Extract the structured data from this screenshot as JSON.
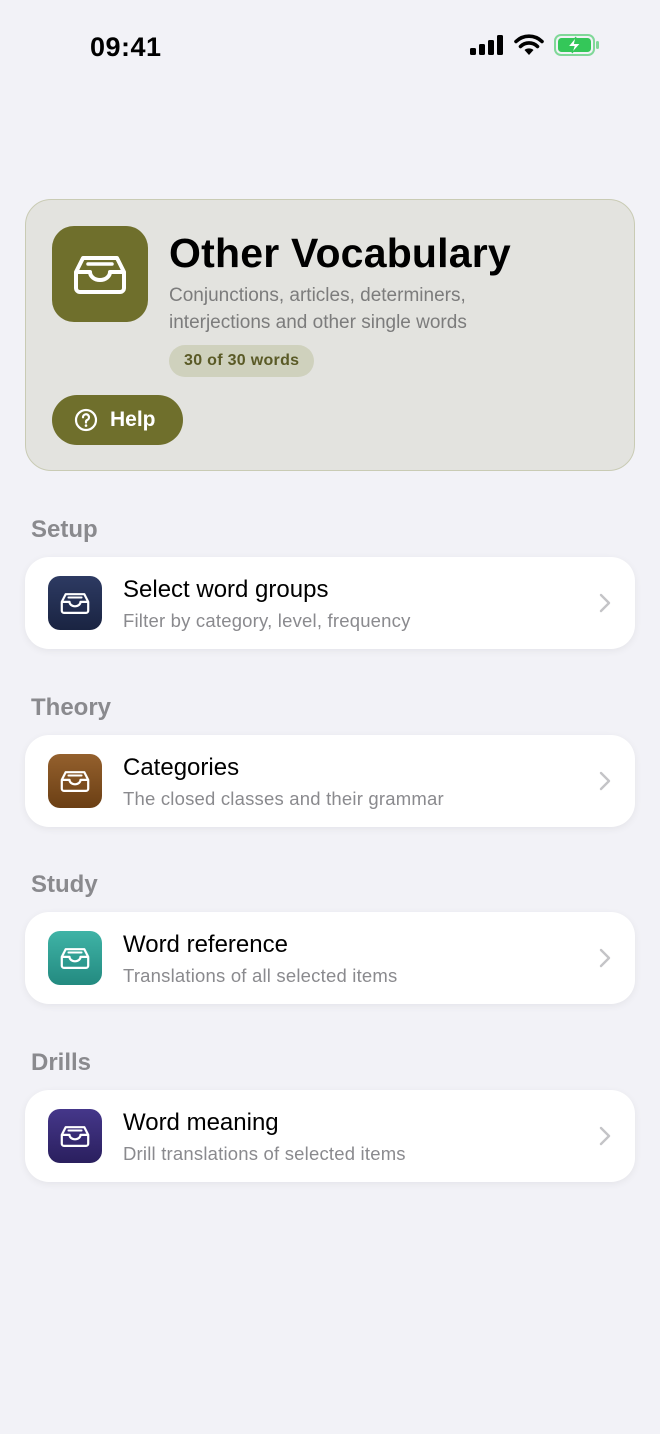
{
  "status_bar": {
    "time": "09:41"
  },
  "hero": {
    "title": "Other Vocabulary",
    "subtitle": "Conjunctions, articles, determiners, interjections and other single words",
    "badge": "30 of 30 words",
    "help_label": "Help",
    "accent_color": "#6f6f2c",
    "icon": "tray-icon"
  },
  "sections": {
    "setup": {
      "header": "Setup",
      "item": {
        "title": "Select word groups",
        "subtitle": "Filter by category, level, frequency",
        "icon_color": "#1f2b4d",
        "icon": "tray-icon"
      }
    },
    "theory": {
      "header": "Theory",
      "item": {
        "title": "Categories",
        "subtitle": "The closed classes and their grammar",
        "icon_color": "#7a4a1c",
        "icon": "tray-icon"
      }
    },
    "study": {
      "header": "Study",
      "item": {
        "title": "Word reference",
        "subtitle": "Translations of all selected items",
        "icon_color": "#2a9a8e",
        "icon": "tray-icon"
      }
    },
    "drills": {
      "header": "Drills",
      "item": {
        "title": "Word meaning",
        "subtitle": "Drill translations of selected items",
        "icon_color": "#33276e",
        "icon": "tray-icon"
      }
    }
  }
}
